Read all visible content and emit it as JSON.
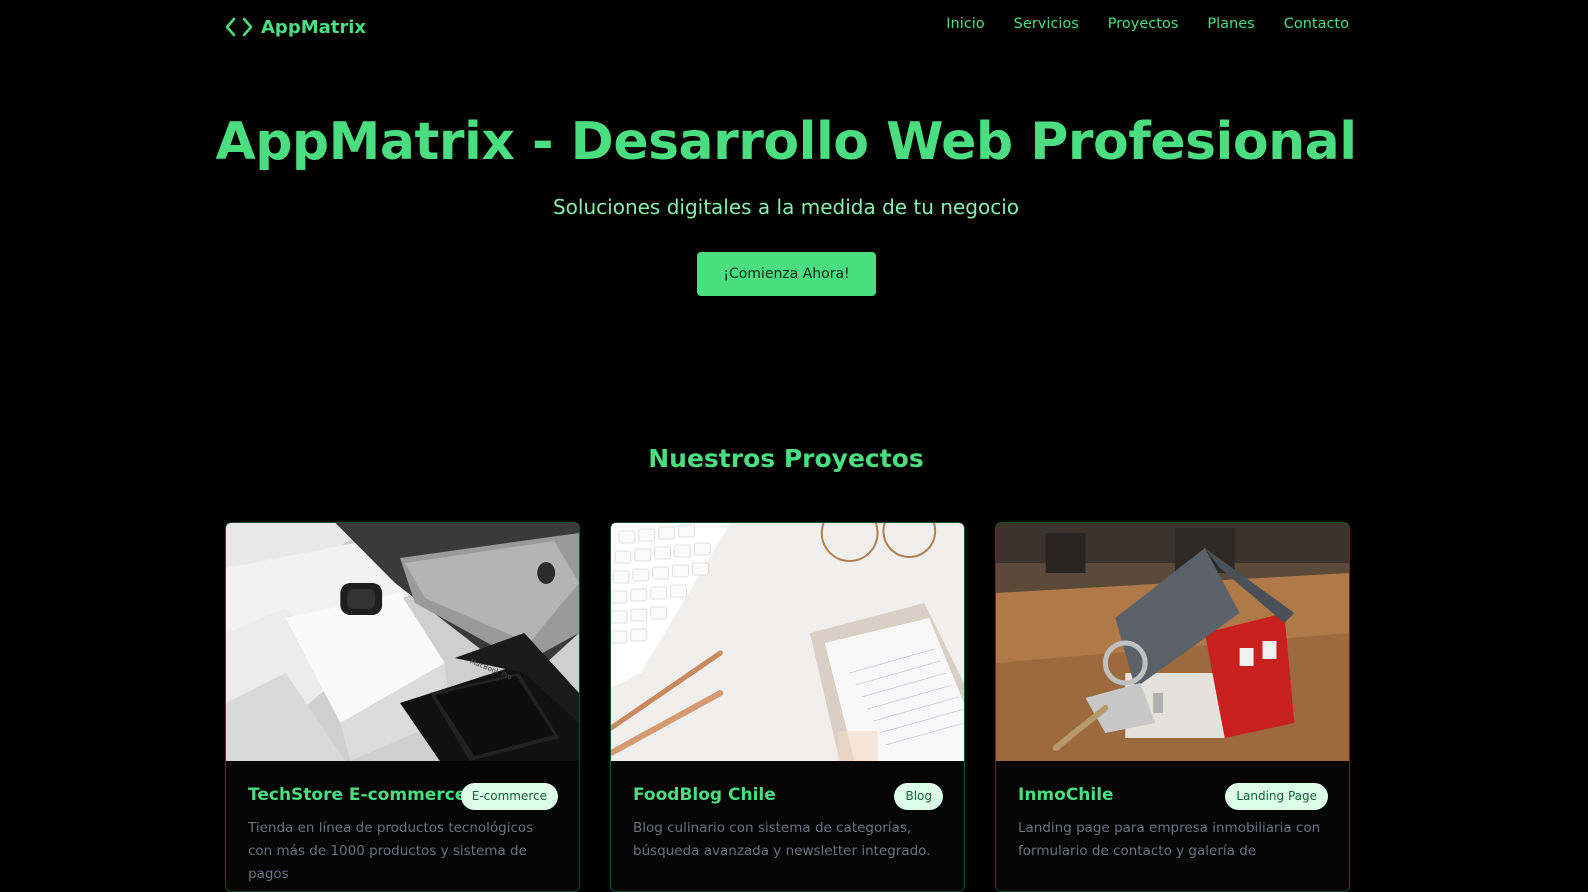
{
  "brand": {
    "name": "AppMatrix",
    "icon": "code-brackets-icon",
    "color": "#4ade80"
  },
  "nav": {
    "links": [
      "Inicio",
      "Servicios",
      "Proyectos",
      "Planes",
      "Contacto"
    ]
  },
  "hero": {
    "title": "AppMatrix - Desarrollo Web Profesional",
    "subtitle": "Soluciones digitales a la medida de tu negocio",
    "cta_label": "¡Comienza Ahora!"
  },
  "projects": {
    "title": "Nuestros Proyectos",
    "cards": [
      {
        "title": "TechStore E-commerce",
        "badge": "E-commerce",
        "description": "Tienda en línea de productos tecnológicos con más de 1000 productos y sistema de pagos",
        "image": "tech-products-photo"
      },
      {
        "title": "FoodBlog Chile",
        "badge": "Blog",
        "description": "Blog culinario con sistema de categorías, búsqueda avanzada y newsletter integrado.",
        "image": "desk-keyboard-photo"
      },
      {
        "title": "InmoChile",
        "badge": "Landing Page",
        "description": "Landing page para empresa inmobiliaria con formulario de contacto y galería de",
        "image": "house-keys-photo"
      }
    ]
  },
  "colors": {
    "accent": "#4ade80",
    "background": "#000000",
    "badge_bg": "#dcfce7",
    "text_muted": "#6b7280"
  }
}
